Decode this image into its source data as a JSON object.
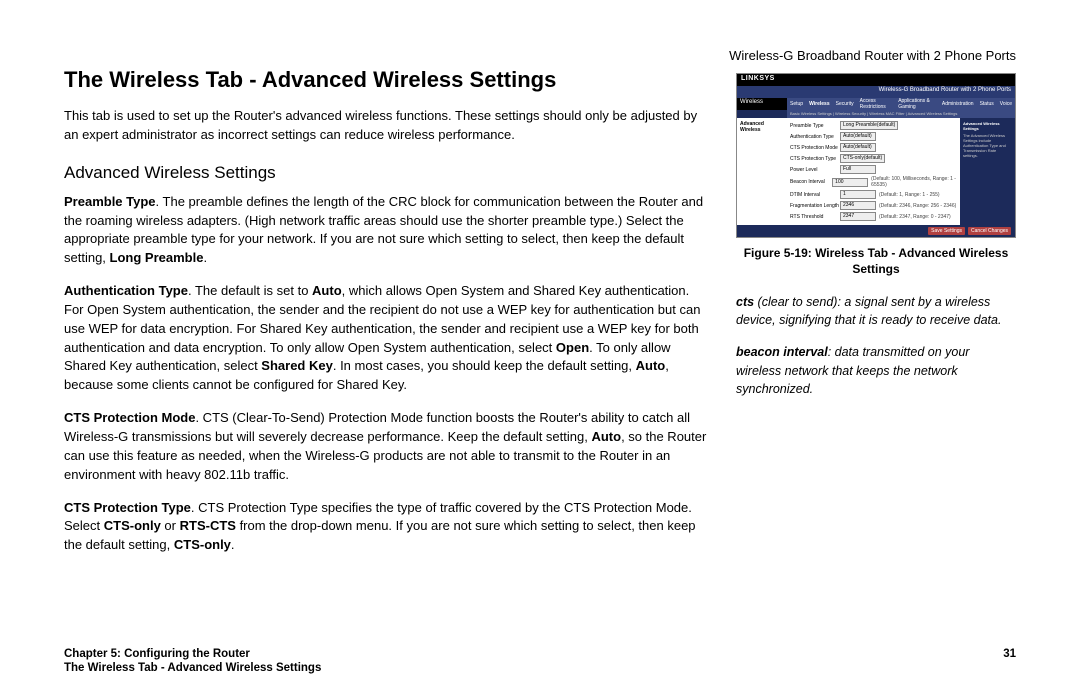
{
  "header_right": "Wireless-G Broadband Router with 2 Phone Ports",
  "title": "The Wireless Tab - Advanced Wireless Settings",
  "intro": "This tab is used to set up the Router's advanced wireless functions. These settings should only be adjusted by an expert administrator as incorrect settings can reduce wireless performance.",
  "section_heading": "Advanced Wireless Settings",
  "para_preamble": {
    "lead": "Preamble Type",
    "text": ". The preamble defines the length of the CRC block for communication between the Router and the roaming wireless adapters. (High network traffic areas should use the shorter preamble type.) Select the appropriate preamble type for your network. If you are not sure which setting to select, then keep the default setting, ",
    "tail_bold": "Long Preamble",
    "tail": "."
  },
  "para_auth": {
    "lead": "Authentication Type",
    "p1": ". The default is set to ",
    "b1": "Auto",
    "p2": ", which allows Open System and Shared Key authentication. For Open System authentication, the sender and the recipient do not use a WEP key for authentication but can use WEP for data encryption. For Shared Key authentication, the sender and recipient use a WEP key for both authentication and data encryption. To only allow Open System authentication, select ",
    "b2": "Open",
    "p3": ". To only allow Shared Key authentication, select ",
    "b3": "Shared Key",
    "p4": ". In most cases, you should keep the default setting, ",
    "b4": "Auto",
    "p5": ", because some clients cannot be configured for Shared Key."
  },
  "para_cts_mode": {
    "lead": "CTS Protection Mode",
    "p1": ". CTS (Clear-To-Send) Protection Mode function boosts the Router's ability to catch all Wireless-G transmissions but will severely decrease performance. Keep the default setting, ",
    "b1": "Auto",
    "p2": ", so the Router can use this feature as needed, when the Wireless-G products are not able to transmit to the Router in an environment with heavy 802.11b traffic."
  },
  "para_cts_type": {
    "lead": "CTS Protection Type",
    "p1": ". CTS Protection Type specifies the type of traffic covered by the CTS Protection Mode. Select ",
    "b1": "CTS-only",
    "p2": " or ",
    "b2": "RTS-CTS",
    "p3": " from the drop-down menu. If you are not sure which setting to select, then keep the default setting, ",
    "b3": "CTS-only",
    "p4": "."
  },
  "figure": {
    "brand": "LINKSYS",
    "product": "Wireless-G Broadband Router with 2 Phone Ports",
    "left_tab": "Wireless",
    "tabs": [
      "Setup",
      "Wireless",
      "Security",
      "Access Restrictions",
      "Applications & Gaming",
      "Administration",
      "Status",
      "Voice"
    ],
    "subtabs": "Basic Wireless Settings  |  Wireless Security  |  Wireless MAC Filter  |  Advanced Wireless Settings",
    "side_label": "Advanced Wireless",
    "right_title": "Advanced Wireless Settings",
    "right_text": "The Advanced Wireless Settings include Authentication Type and Transmission Rate settings.",
    "rows": [
      {
        "lbl": "Preamble Type",
        "val": "Long Preamble(default)"
      },
      {
        "lbl": "Authentication Type",
        "val": "Auto(default)"
      },
      {
        "lbl": "CTS Protection Mode",
        "val": "Auto(default)"
      },
      {
        "lbl": "CTS Protection Type",
        "val": "CTS-only(default)"
      },
      {
        "lbl": "Power Level",
        "val": "Full"
      },
      {
        "lbl": "Beacon Interval",
        "val": "100",
        "hint": "(Default: 100, Milliseconds, Range: 1 - 65535)"
      },
      {
        "lbl": "DTIM Interval",
        "val": "1",
        "hint": "(Default: 1, Range: 1 - 255)"
      },
      {
        "lbl": "Fragmentation Length",
        "val": "2346",
        "hint": "(Default: 2346, Range: 256 - 2346)"
      },
      {
        "lbl": "RTS Threshold",
        "val": "2347",
        "hint": "(Default: 2347, Range: 0 - 2347)"
      }
    ],
    "btn_save": "Save Settings",
    "btn_cancel": "Cancel Changes",
    "caption": "Figure 5-19: Wireless Tab - Advanced Wireless Settings"
  },
  "sidenotes": {
    "cts": {
      "term": "cts",
      "def": " (clear to send): a signal sent by a wireless device, signifying that it is ready to receive data."
    },
    "beacon": {
      "term": "beacon interval",
      "def": ": data transmitted on your wireless network that keeps the network synchronized."
    }
  },
  "footer": {
    "chapter": "Chapter 5: Configuring the Router",
    "page": "31",
    "section": "The Wireless Tab - Advanced Wireless Settings"
  }
}
